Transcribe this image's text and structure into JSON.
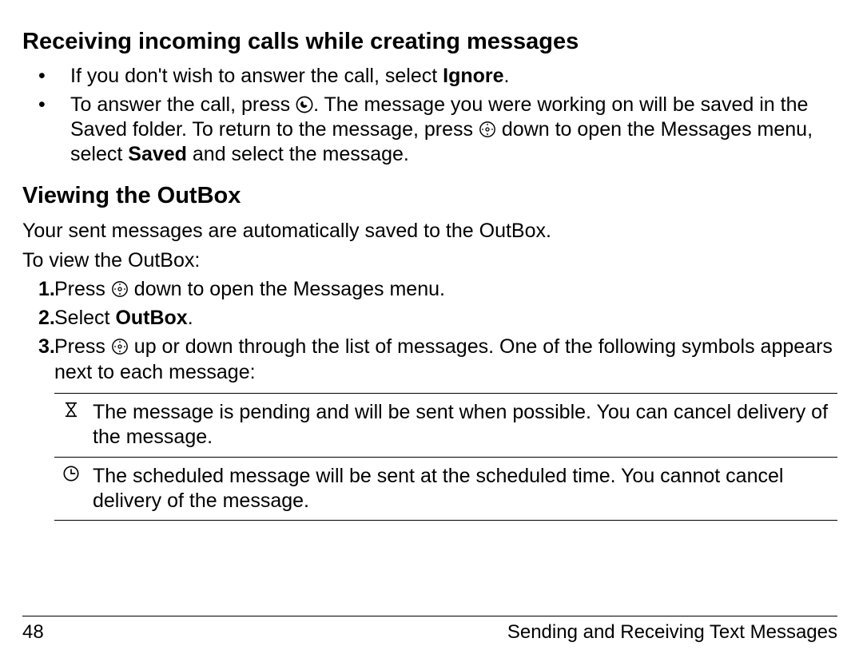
{
  "section1": {
    "heading": "Receiving incoming calls while creating messages",
    "bullet1_a": "If you don't wish to answer the call, select ",
    "bullet1_bold": "Ignore",
    "bullet1_b": ".",
    "bullet2_a": "To answer the call, press ",
    "bullet2_b": ". The message you were working on will be saved in the Saved folder. To return to the message, press ",
    "bullet2_c": " down to open the Messages menu, select ",
    "bullet2_bold": "Saved",
    "bullet2_d": " and select the message."
  },
  "section2": {
    "heading": "Viewing the OutBox",
    "para1": "Your sent messages are automatically saved to the OutBox.",
    "para2": "To view the OutBox:",
    "step1_a": "Press ",
    "step1_b": " down to open the Messages menu.",
    "step2_a": "Select ",
    "step2_bold": "OutBox",
    "step2_b": ".",
    "step3_a": "Press ",
    "step3_b": " up or down through the list of messages. One of the following symbols appears next to each message:",
    "sym1_text": "The message is pending and will be sent when possible. You can cancel delivery of the message.",
    "sym2_text": "The scheduled message will be sent at the scheduled time. You cannot cancel delivery of the message."
  },
  "footer": {
    "page": "48",
    "title": "Sending and Receiving Text Messages"
  },
  "numbers": {
    "n1": "1.",
    "n2": "2.",
    "n3": "3."
  },
  "bullet_char": "•"
}
